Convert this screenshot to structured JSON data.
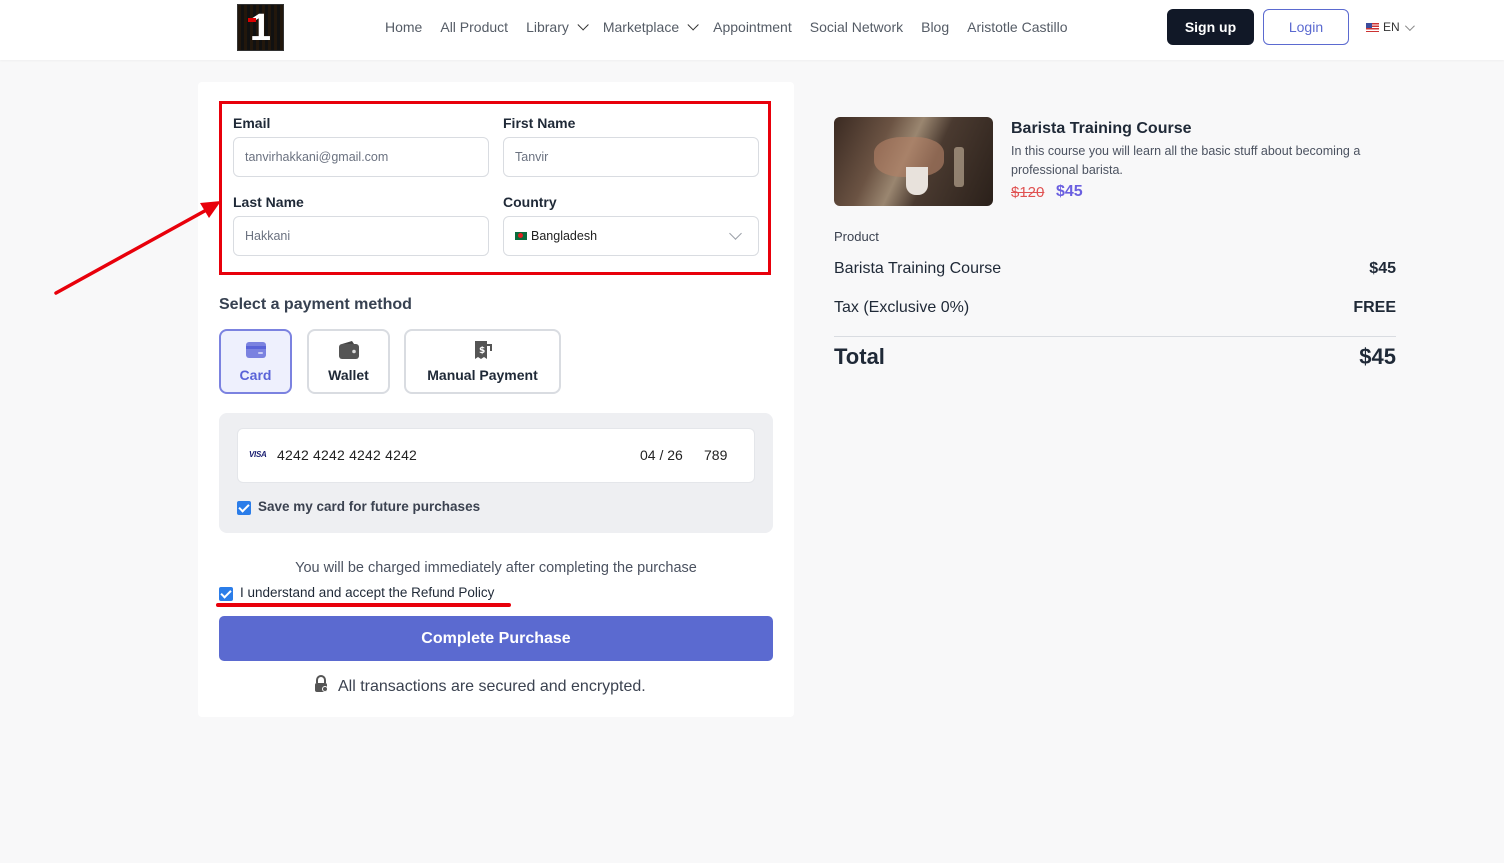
{
  "header": {
    "logo_text": "1",
    "nav": [
      {
        "label": "Home",
        "dropdown": false
      },
      {
        "label": "All Product",
        "dropdown": false
      },
      {
        "label": "Library",
        "dropdown": true
      },
      {
        "label": "Marketplace",
        "dropdown": true
      },
      {
        "label": "Appointment",
        "dropdown": false
      },
      {
        "label": "Social Network",
        "dropdown": false
      },
      {
        "label": "Blog",
        "dropdown": false
      },
      {
        "label": "Aristotle Castillo",
        "dropdown": false
      }
    ],
    "signup_label": "Sign up",
    "login_label": "Login",
    "language": "EN"
  },
  "form": {
    "email_label": "Email",
    "email_value": "tanvirhakkani@gmail.com",
    "first_name_label": "First Name",
    "first_name_value": "Tanvir",
    "last_name_label": "Last Name",
    "last_name_value": "Hakkani",
    "country_label": "Country",
    "country_value": "Bangladesh"
  },
  "payment": {
    "title": "Select a payment method",
    "methods": [
      {
        "label": "Card",
        "icon": "card-icon",
        "active": true
      },
      {
        "label": "Wallet",
        "icon": "wallet-icon",
        "active": false
      },
      {
        "label": "Manual Payment",
        "icon": "receipt-icon",
        "active": false
      }
    ],
    "card_brand": "VISA",
    "card_number": "4242 4242 4242 4242",
    "card_expiry": "04 / 26",
    "card_cvc": "789",
    "save_card_label": "Save my card for future purchases",
    "save_card_checked": true
  },
  "checkout": {
    "charge_note": "You will be charged immediately after completing the purchase",
    "refund_label": "I understand and accept the Refund Policy",
    "refund_checked": true,
    "complete_label": "Complete Purchase",
    "secure_note": "All transactions are secured and encrypted."
  },
  "summary": {
    "course_title": "Barista Training Course",
    "course_description": "In this course you will learn all the basic stuff about becoming a professional barista.",
    "price_old": "$120",
    "price_new": "$45",
    "product_label": "Product",
    "rows": [
      {
        "label": "Barista Training Course",
        "value": "$45"
      },
      {
        "label": "Tax (Exclusive 0%)",
        "value": "FREE"
      }
    ],
    "total_label": "Total",
    "total_value": "$45"
  },
  "colors": {
    "accent": "#5b6ad0",
    "highlight": "#e8000b",
    "dark_button": "#111827"
  }
}
